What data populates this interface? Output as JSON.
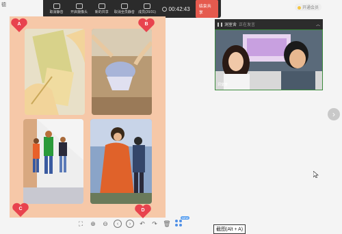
{
  "app": {
    "corner_label": "德"
  },
  "top_badge": "开通会员",
  "toolbar": {
    "buttons": [
      {
        "label": "取消静音",
        "icon": "mic-muted-icon"
      },
      {
        "label": "开启摄像头",
        "icon": "camera-off-icon"
      },
      {
        "label": "新的共享",
        "icon": "share-screen-icon"
      },
      {
        "label": "取消全员静音",
        "icon": "mute-all-icon"
      },
      {
        "label": "成员(20/31)",
        "icon": "members-icon"
      }
    ],
    "timer": "00:42:43",
    "end_share_label": "结束共享"
  },
  "board": {
    "hearts": [
      "A",
      "B",
      "C",
      "D"
    ],
    "colors": {
      "background": "#f6c8a8",
      "heart": "#e8434e"
    }
  },
  "video_panel": {
    "title": "洞室舍",
    "subtitle": "正在发言",
    "participant_name": "洞室舍"
  },
  "bottom_bar": {
    "icons": [
      "fit-screen-icon",
      "zoom-in-icon",
      "zoom-out-icon",
      "prev-page-icon",
      "next-page-icon",
      "undo-icon",
      "redo-icon",
      "delete-icon",
      "apps-icon"
    ],
    "apps_badge": "NEW"
  },
  "tooltip": "截图(Alt + A)"
}
